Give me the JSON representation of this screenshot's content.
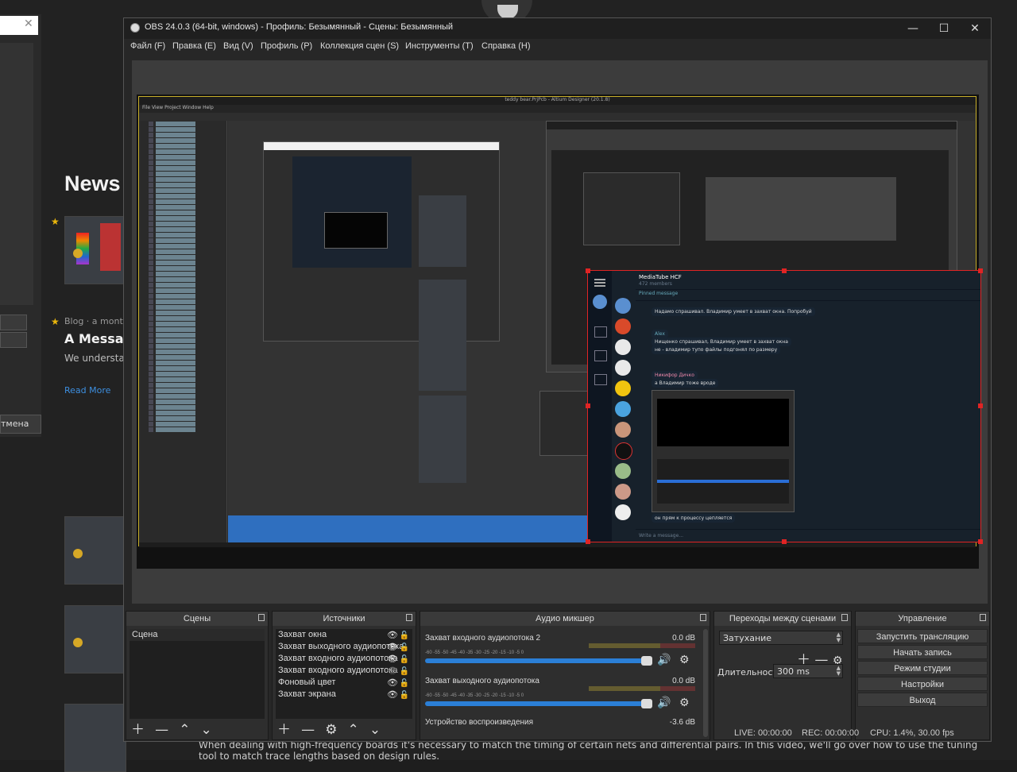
{
  "window": {
    "title": "OBS 24.0.3 (64-bit, windows) - Профиль: Безымянный - Сцены: Безымянный",
    "minimize": "—",
    "maximize": "☐",
    "close": "✕"
  },
  "menu": [
    "Файл (F)",
    "Правка (E)",
    "Вид (V)",
    "Профиль (P)",
    "Коллекция сцен (S)",
    "Инструменты (T)",
    "Справка (H)"
  ],
  "docks": {
    "scenes": {
      "title": "Сцены",
      "items": [
        "Сцена"
      ]
    },
    "sources": {
      "title": "Источники",
      "items": [
        "Захват окна",
        "Захват выходного аудиопотока",
        "Захват входного аудиопотока",
        "Захват входного аудиопотока",
        "Фоновый цвет",
        "Захват экрана"
      ]
    },
    "mixer": {
      "title": "Аудио микшер",
      "channels": [
        {
          "name": "Захват входного аудиопотока 2",
          "db": "0.0 dB"
        },
        {
          "name": "Захват выходного аудиопотока",
          "db": "0.0 dB"
        },
        {
          "name": "Устройство воспроизведения",
          "db": "-3.6 dB"
        }
      ],
      "scale": "-60 -55 -50 -45 -40 -35 -30 -25 -20 -15 -10 -5 0"
    },
    "transitions": {
      "title": "Переходы между сценами",
      "selected": "Затухание",
      "duration_label": "Длительность",
      "duration_value": "300 ms"
    },
    "controls": {
      "title": "Управление",
      "buttons": [
        "Запустить трансляцию",
        "Начать запись",
        "Режим студии",
        "Настройки",
        "Выход"
      ]
    }
  },
  "status": {
    "live": "LIVE: 00:00:00",
    "rec": "REC: 00:00:00",
    "cpu": "CPU: 1.4%, 30.00 fps"
  },
  "preview": {
    "inner_title": "teddy bear.PrjPcb - Altium Designer (20.1.8)",
    "inner_menu": "File  View  Project  Window  Help",
    "telegram": {
      "chat_title": "MediaTube HCF",
      "chat_sub": "472 members",
      "pinned": "Pinned message",
      "msg1": "Надамо спрашивал. Владимир умеет в захват окна. Попробуй",
      "msg2": "Alex",
      "msg3": "Нищенко спрашивал, Владимир умеет в захват окна",
      "msg4": "не - владимир тупо файлы подгонял по размеру",
      "msg5": "Никифор Дичко",
      "msg6": "а Владимир тоже вроде",
      "msg7": "он прям к процессу цепляется",
      "input_placeholder": "Write a message..."
    }
  },
  "background": {
    "news": "News",
    "blog": "Blog · a month",
    "message": "A Message",
    "paragraph": "We understand your teams ar",
    "read_more": "Read More",
    "footer": "When dealing with high-frequency boards it's necessary to match the timing of certain nets and differential pairs. In this video, we'll go over how to use the tuning tool to match trace lengths based on design rules.",
    "left_button": "тмена"
  }
}
